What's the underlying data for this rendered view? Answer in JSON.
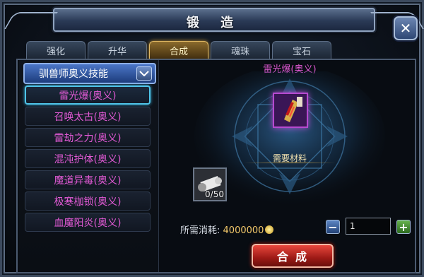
{
  "window": {
    "title": "锻 造"
  },
  "tabs": [
    {
      "label": "强化",
      "active": false
    },
    {
      "label": "升华",
      "active": false
    },
    {
      "label": "合成",
      "active": true
    },
    {
      "label": "魂珠",
      "active": false
    },
    {
      "label": "宝石",
      "active": false
    }
  ],
  "category": {
    "selected": "驯兽师奥义技能"
  },
  "skills": [
    {
      "label": "雷光爆(奥义)",
      "selected": true
    },
    {
      "label": "召唤太古(奥义)",
      "selected": false
    },
    {
      "label": "雷劫之力(奥义)",
      "selected": false
    },
    {
      "label": "混沌护体(奥义)",
      "selected": false
    },
    {
      "label": "魔道异毒(奥义)",
      "selected": false
    },
    {
      "label": "极寒枷锁(奥义)",
      "selected": false
    },
    {
      "label": "血魔阳炎(奥义)",
      "selected": false
    }
  ],
  "detail": {
    "item_name": "雷光爆(奥义)",
    "materials_label": "需要材料",
    "material_count": "0/50",
    "cost_label": "所需消耗:",
    "cost_value": "4000000",
    "quantity": "1",
    "synth_label": "合成"
  },
  "colors": {
    "skill_text": "#e35ad6",
    "accent_gold": "#e1b964",
    "synth_red": "#c8261d"
  }
}
